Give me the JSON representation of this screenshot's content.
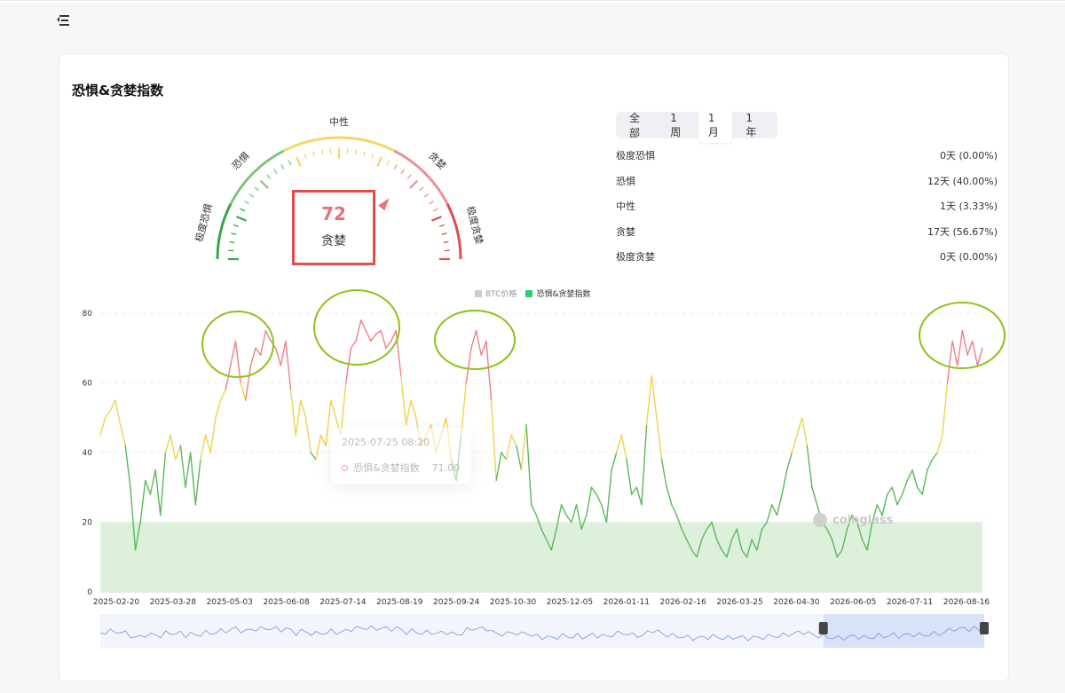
{
  "title": "恐惧&贪婪指数",
  "tabs": [
    {
      "label": "全部",
      "active": false
    },
    {
      "label": "1周",
      "active": false
    },
    {
      "label": "1月",
      "active": true
    },
    {
      "label": "1年",
      "active": false
    }
  ],
  "stats": [
    {
      "label": "极度恐惧",
      "value": "0天 (0.00%)"
    },
    {
      "label": "恐惧",
      "value": "12天 (40.00%)"
    },
    {
      "label": "中性",
      "value": "1天 (3.33%)"
    },
    {
      "label": "贪婪",
      "value": "17天 (56.67%)"
    },
    {
      "label": "极度贪婪",
      "value": "0天 (0.00%)"
    }
  ],
  "gauge": {
    "value": "72",
    "label": "贪婪",
    "zones": [
      "极度恐惧",
      "恐惧",
      "中性",
      "贪婪",
      "极度贪婪"
    ],
    "colors": {
      "extreme_fear": "#3aa54a",
      "fear": "#7bc67e",
      "neutral": "#f5d769",
      "greed": "#ec8f94",
      "extreme_greed": "#e24c4c"
    }
  },
  "legend": [
    {
      "name": "BTC价格",
      "color": "#cccccc",
      "active": false
    },
    {
      "name": "恐惧&贪婪指数",
      "color": "#2ecc71",
      "active": true
    }
  ],
  "tooltip": {
    "date": "2025-07-25 08:20",
    "series": "恐惧&贪婪指数",
    "value": "71.00"
  },
  "watermark": "coinglass",
  "chart_data": {
    "type": "line",
    "series_name": "恐惧&贪婪指数",
    "ylim": [
      0,
      80
    ],
    "yticks": [
      0,
      20,
      40,
      60,
      80
    ],
    "x_tick_labels": [
      "2025-02-20",
      "2025-03-28",
      "2025-05-03",
      "2025-06-08",
      "2025-07-14",
      "2025-08-19",
      "2025-09-24",
      "2025-10-30",
      "2025-12-05",
      "2026-01-11",
      "2026-02-16",
      "2026-03-25",
      "2026-04-30",
      "2026-06-05",
      "2026-07-11",
      "2026-08-16"
    ],
    "color_thresholds": {
      "fear_below": 40,
      "greed_above": 60
    },
    "colors": {
      "fear": "#5cb85c",
      "neutral": "#f2d24e",
      "greed": "#ef7f88",
      "band": "#d8eed8"
    },
    "extreme_fear_band": [
      0,
      20
    ],
    "values": [
      45,
      50,
      52,
      55,
      48,
      42,
      30,
      12,
      20,
      32,
      28,
      35,
      22,
      40,
      45,
      38,
      42,
      30,
      40,
      25,
      38,
      45,
      40,
      50,
      55,
      58,
      65,
      72,
      60,
      55,
      65,
      70,
      68,
      75,
      72,
      70,
      65,
      72,
      58,
      45,
      55,
      50,
      40,
      38,
      45,
      42,
      55,
      50,
      45,
      60,
      70,
      72,
      78,
      75,
      72,
      74,
      75,
      70,
      72,
      75,
      62,
      48,
      55,
      50,
      42,
      45,
      48,
      40,
      45,
      50,
      38,
      32,
      45,
      60,
      70,
      75,
      68,
      72,
      55,
      32,
      40,
      38,
      45,
      42,
      35,
      48,
      25,
      22,
      18,
      15,
      12,
      18,
      25,
      22,
      20,
      25,
      18,
      22,
      30,
      28,
      25,
      20,
      35,
      40,
      45,
      38,
      28,
      30,
      25,
      48,
      62,
      50,
      38,
      30,
      25,
      22,
      18,
      15,
      12,
      10,
      15,
      18,
      20,
      15,
      12,
      10,
      15,
      18,
      12,
      10,
      15,
      12,
      18,
      20,
      25,
      22,
      28,
      35,
      40,
      45,
      50,
      42,
      30,
      25,
      20,
      18,
      15,
      10,
      12,
      18,
      22,
      20,
      15,
      12,
      20,
      25,
      22,
      28,
      30,
      25,
      28,
      32,
      35,
      30,
      28,
      35,
      38,
      40,
      45,
      60,
      72,
      65,
      75,
      68,
      72,
      65,
      70
    ],
    "overview_label": "",
    "zoom_window": [
      0.818,
      1.0
    ]
  }
}
